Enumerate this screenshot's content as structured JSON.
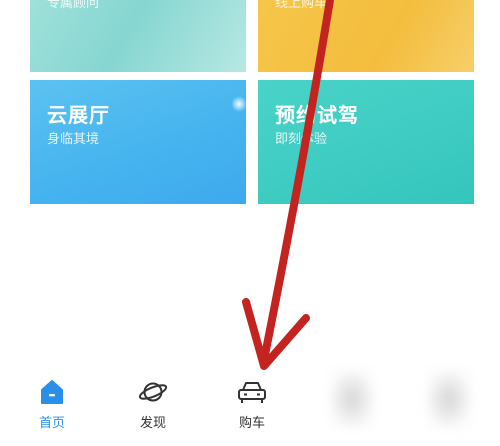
{
  "cards": {
    "top_left": {
      "subtitle": "专属顾问"
    },
    "top_right": {
      "subtitle": "线上购车"
    },
    "cloud_hall": {
      "title": "云展厅",
      "subtitle": "身临其境"
    },
    "test_drive": {
      "title": "预约试驾",
      "subtitle": "即刻体验"
    }
  },
  "tabbar": {
    "home": {
      "label": "首页",
      "icon": "home-icon"
    },
    "discover": {
      "label": "发现",
      "icon": "planet-icon"
    },
    "buy": {
      "label": "购车",
      "icon": "car-icon"
    }
  },
  "colors": {
    "active_tab": "#2a8fe8",
    "arrow": "#c4241f"
  }
}
